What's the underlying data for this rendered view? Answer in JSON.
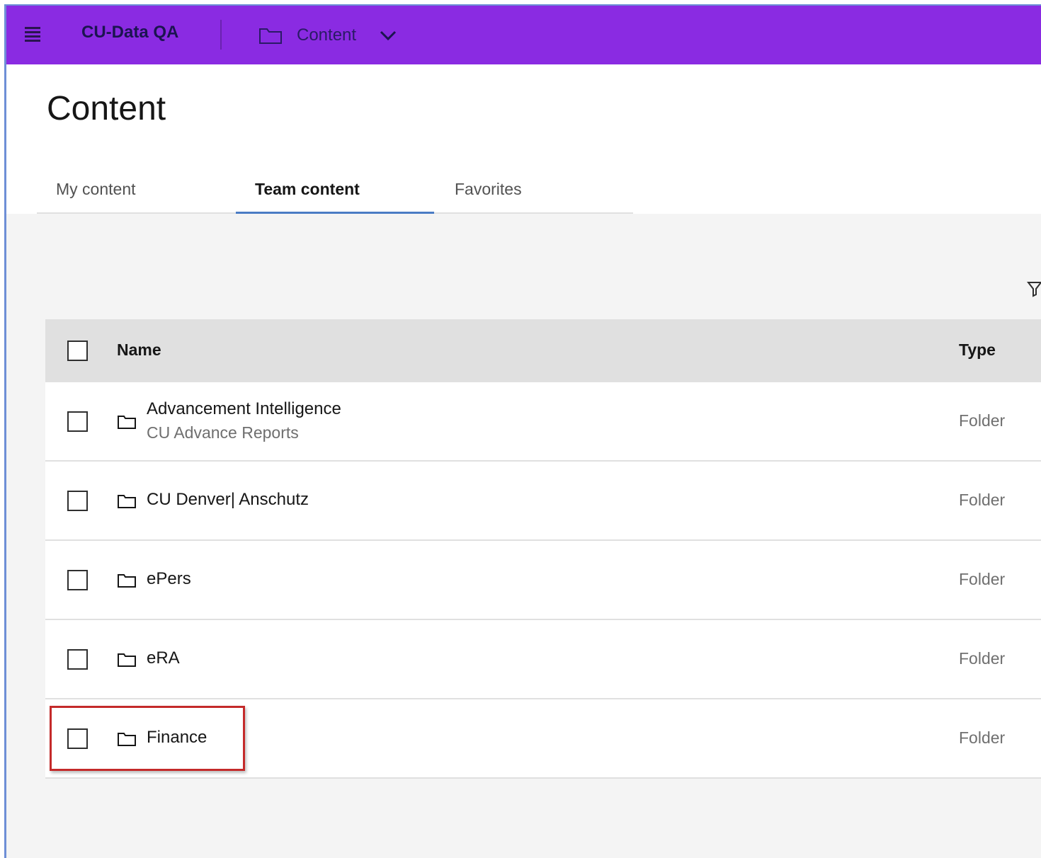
{
  "header": {
    "app_title": "CU-Data QA",
    "nav_label": "Content",
    "icons": {
      "menu": "hamburger-menu-icon",
      "folder": "folder-icon",
      "dropdown": "chevron-down-icon"
    },
    "colors": {
      "bar": "#8a2be2"
    }
  },
  "page": {
    "title": "Content"
  },
  "tabs": [
    {
      "label": "My content",
      "active": false
    },
    {
      "label": "Team content",
      "active": true
    },
    {
      "label": "Favorites",
      "active": false
    }
  ],
  "table": {
    "headers": {
      "name": "Name",
      "type": "Type"
    },
    "rows": [
      {
        "name": "Advancement Intelligence",
        "subtitle": "CU Advance Reports",
        "type": "Folder"
      },
      {
        "name": "CU Denver| Anschutz",
        "type": "Folder"
      },
      {
        "name": "ePers",
        "type": "Folder"
      },
      {
        "name": "eRA",
        "type": "Folder"
      },
      {
        "name": "Finance",
        "type": "Folder",
        "highlighted": true
      }
    ]
  },
  "toolbar": {
    "filter_icon": "filter-icon"
  }
}
